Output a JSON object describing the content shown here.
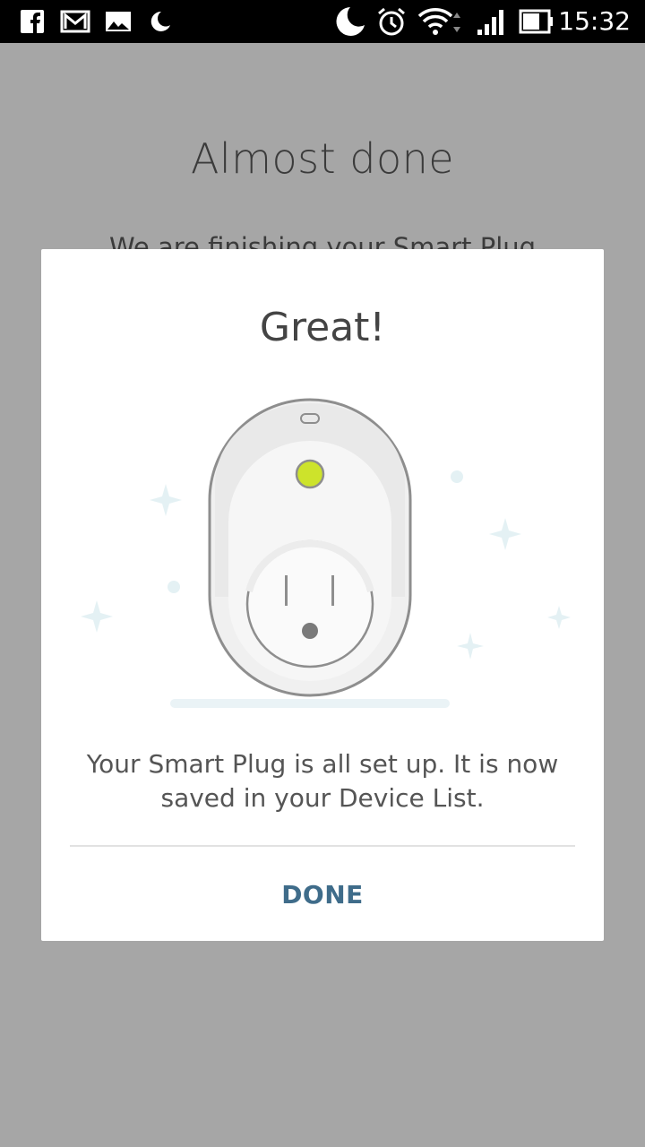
{
  "status_bar": {
    "time": "15:32",
    "left_icons": [
      "facebook-icon",
      "gmail-icon",
      "gallery-icon",
      "moon-icon"
    ],
    "right_icons": [
      "do-not-disturb-icon",
      "alarm-icon",
      "wifi-icon",
      "signal-icon",
      "battery-icon"
    ]
  },
  "background_screen": {
    "title": "Almost done",
    "text": "We are finishing your Smart Plug"
  },
  "dialog": {
    "title": "Great!",
    "message": "Your Smart Plug is all set up. It is now saved in your Device List.",
    "done_label": "DONE"
  },
  "colors": {
    "overlay": "#a6a6a6",
    "accent": "#3f6c8a",
    "led": "#cde32b",
    "sparkle": "#e4f1f4"
  }
}
